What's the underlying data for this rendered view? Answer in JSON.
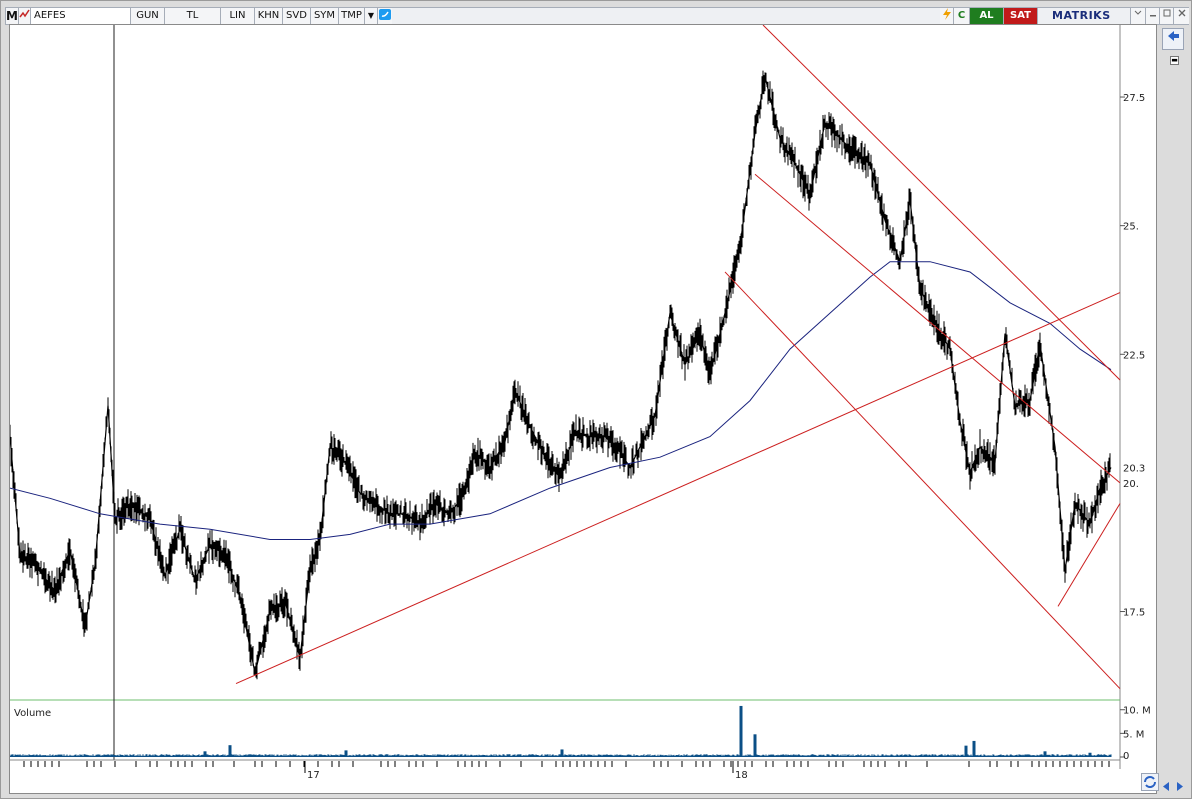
{
  "toolbar": {
    "logo": "M",
    "symbol": "AEFES",
    "period": "GUN",
    "currency": "TL",
    "scale": "LIN",
    "tools": [
      "KHN",
      "SVD",
      "SYM",
      "TMP"
    ],
    "buy_label": "AL",
    "sell_label": "SAT",
    "brand": "MATRIKS"
  },
  "colors": {
    "price": "#000000",
    "moving_average": "#1a237e",
    "trendlines": "#cc1f1f",
    "volume": "#0b4f86",
    "grid_accent": "#6fbf6f",
    "buy": "#1f7d1f",
    "sell": "#c11a1a"
  },
  "icons": [
    "chart-icon",
    "twitter-icon",
    "lightning-icon",
    "refresh-icon",
    "minimize-icon",
    "restore-icon",
    "close-icon",
    "back-arrow-icon",
    "sync-icon",
    "scroll-left-icon",
    "scroll-right-icon"
  ],
  "chart_data": {
    "type": "line",
    "price_pane": {
      "ylim": [
        15.8,
        28.9
      ],
      "y_ticks": [
        27.5,
        25.0,
        22.5,
        17.5
      ],
      "y_tick_labels": [
        "27.5",
        "25.",
        "22.5",
        "17.5"
      ],
      "last_value_labels": [
        "20.3",
        "20."
      ],
      "x_tick_labels": [
        "17",
        "18"
      ],
      "series": [
        {
          "kind": "price",
          "points": [
            [
              0,
              20.9
            ],
            [
              10,
              18.6
            ],
            [
              25,
              18.4
            ],
            [
              45,
              17.9
            ],
            [
              60,
              18.7
            ],
            [
              75,
              17.2
            ],
            [
              85,
              18.4
            ],
            [
              98,
              21.5
            ],
            [
              105,
              19.3
            ],
            [
              120,
              19.6
            ],
            [
              140,
              19.3
            ],
            [
              155,
              18.2
            ],
            [
              170,
              19.1
            ],
            [
              185,
              18.1
            ],
            [
              200,
              18.8
            ],
            [
              215,
              18.6
            ],
            [
              230,
              17.8
            ],
            [
              245,
              16.3
            ],
            [
              260,
              17.5
            ],
            [
              275,
              17.7
            ],
            [
              290,
              16.6
            ],
            [
              300,
              18.3
            ],
            [
              310,
              18.9
            ],
            [
              320,
              20.7
            ],
            [
              335,
              20.4
            ],
            [
              350,
              19.8
            ],
            [
              365,
              19.6
            ],
            [
              380,
              19.4
            ],
            [
              395,
              19.4
            ],
            [
              410,
              19.2
            ],
            [
              425,
              19.6
            ],
            [
              440,
              19.4
            ],
            [
              455,
              19.8
            ],
            [
              465,
              20.6
            ],
            [
              480,
              20.3
            ],
            [
              495,
              20.8
            ],
            [
              505,
              21.8
            ],
            [
              520,
              21.1
            ],
            [
              535,
              20.5
            ],
            [
              550,
              20.1
            ],
            [
              565,
              21.0
            ],
            [
              580,
              20.9
            ],
            [
              595,
              20.9
            ],
            [
              610,
              20.6
            ],
            [
              620,
              20.3
            ],
            [
              630,
              20.7
            ],
            [
              645,
              21.3
            ],
            [
              660,
              23.3
            ],
            [
              675,
              22.3
            ],
            [
              690,
              22.9
            ],
            [
              700,
              22.1
            ],
            [
              715,
              23.3
            ],
            [
              730,
              24.6
            ],
            [
              745,
              26.8
            ],
            [
              755,
              27.9
            ],
            [
              770,
              26.7
            ],
            [
              785,
              26.2
            ],
            [
              800,
              25.6
            ],
            [
              815,
              27.0
            ],
            [
              830,
              26.7
            ],
            [
              845,
              26.4
            ],
            [
              860,
              26.2
            ],
            [
              875,
              25.1
            ],
            [
              890,
              24.3
            ],
            [
              900,
              25.5
            ],
            [
              910,
              23.8
            ],
            [
              925,
              23.1
            ],
            [
              940,
              22.6
            ],
            [
              950,
              21.2
            ],
            [
              960,
              20.2
            ],
            [
              970,
              20.7
            ],
            [
              985,
              20.4
            ],
            [
              995,
              22.9
            ],
            [
              1005,
              21.5
            ],
            [
              1020,
              21.6
            ],
            [
              1030,
              22.7
            ],
            [
              1045,
              20.7
            ],
            [
              1055,
              18.3
            ],
            [
              1065,
              19.6
            ],
            [
              1080,
              19.2
            ],
            [
              1090,
              19.9
            ],
            [
              1101,
              20.3
            ]
          ]
        },
        {
          "kind": "moving_average",
          "points": [
            [
              0,
              19.9
            ],
            [
              40,
              19.7
            ],
            [
              90,
              19.4
            ],
            [
              150,
              19.2
            ],
            [
              200,
              19.1
            ],
            [
              260,
              18.9
            ],
            [
              300,
              18.9
            ],
            [
              340,
              19.0
            ],
            [
              380,
              19.2
            ],
            [
              420,
              19.2
            ],
            [
              480,
              19.4
            ],
            [
              540,
              19.9
            ],
            [
              600,
              20.3
            ],
            [
              650,
              20.5
            ],
            [
              700,
              20.9
            ],
            [
              740,
              21.6
            ],
            [
              780,
              22.6
            ],
            [
              820,
              23.3
            ],
            [
              860,
              24.0
            ],
            [
              880,
              24.3
            ],
            [
              900,
              24.3
            ],
            [
              920,
              24.3
            ],
            [
              960,
              24.1
            ],
            [
              1000,
              23.5
            ],
            [
              1040,
              23.1
            ],
            [
              1070,
              22.6
            ],
            [
              1101,
              22.2
            ]
          ]
        }
      ],
      "trendlines": [
        {
          "from": [
            226,
            16.1
          ],
          "to": [
            1110,
            23.7
          ]
        },
        {
          "from": [
            753,
            28.9
          ],
          "to": [
            1110,
            22.0
          ]
        },
        {
          "from": [
            745,
            26.0
          ],
          "to": [
            1110,
            20.0
          ]
        },
        {
          "from": [
            715,
            24.1
          ],
          "to": [
            1110,
            16.0
          ]
        },
        {
          "from": [
            1048,
            17.6
          ],
          "to": [
            1110,
            19.6
          ]
        }
      ]
    },
    "volume_pane": {
      "title": "Volume",
      "ylim": [
        0,
        11
      ],
      "y_tick_labels": [
        "10. M",
        "5. M",
        "0"
      ],
      "y_ticks": [
        10,
        5,
        0
      ],
      "spikes": [
        [
          195,
          1.2
        ],
        [
          220,
          2.5
        ],
        [
          336,
          1.4
        ],
        [
          552,
          1.6
        ],
        [
          731,
          10.8
        ],
        [
          745,
          4.8
        ],
        [
          956,
          2.4
        ],
        [
          964,
          3.4
        ],
        [
          1035,
          1.2
        ],
        [
          1080,
          0.9
        ]
      ],
      "baseline": 0.4
    }
  }
}
